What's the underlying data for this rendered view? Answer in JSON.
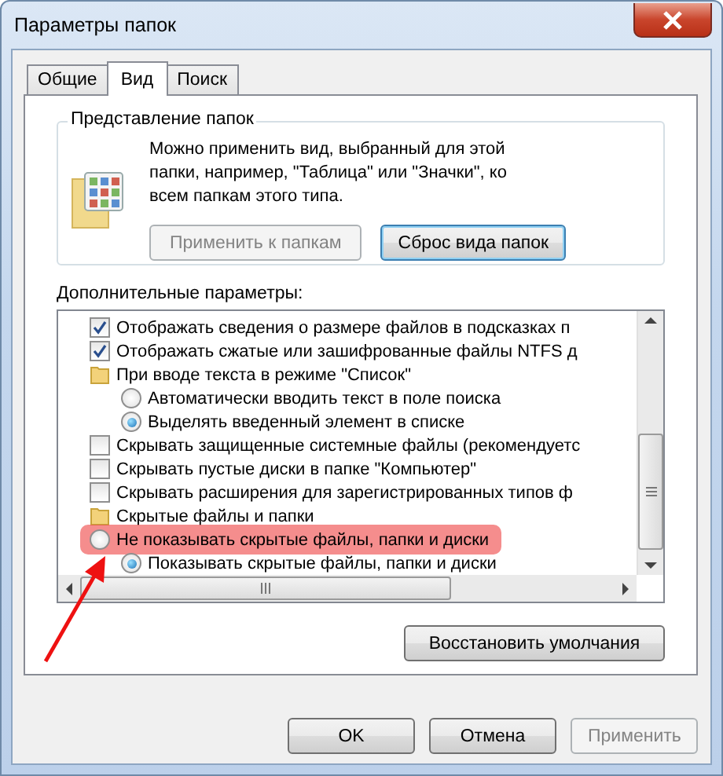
{
  "window": {
    "title": "Параметры папок"
  },
  "tabs": [
    {
      "label": "Общие",
      "selected": false
    },
    {
      "label": "Вид",
      "selected": true
    },
    {
      "label": "Поиск",
      "selected": false
    }
  ],
  "folder_views": {
    "title": "Представление папок",
    "description": "Можно применить вид, выбранный для этой папки, например, \"Таблица\" или \"Значки\", ко всем папкам этого типа.",
    "buttons": [
      {
        "label": "Применить к папкам",
        "disabled": true
      },
      {
        "label": "Сброс вида папок",
        "disabled": false
      }
    ]
  },
  "advanced": {
    "title": "Дополнительные параметры:",
    "items": [
      {
        "kind": "checkbox",
        "label": "Отображать сведения о размере файлов в подсказках п",
        "checked": true
      },
      {
        "kind": "checkbox",
        "label": "Отображать сжатые или зашифрованные файлы NTFS д",
        "checked": true
      },
      {
        "kind": "folder",
        "label": "При вводе текста в режиме \"Список\"",
        "children": [
          {
            "kind": "radio",
            "label": "Автоматически вводить текст в поле поиска",
            "selected": false,
            "highlighted": false
          },
          {
            "kind": "radio",
            "label": "Выделять введенный элемент в списке",
            "selected": true,
            "highlighted": false
          }
        ]
      },
      {
        "kind": "checkbox",
        "label": "Скрывать защищенные системные файлы (рекомендуетс",
        "checked": false
      },
      {
        "kind": "checkbox",
        "label": "Скрывать пустые диски в папке \"Компьютер\"",
        "checked": false
      },
      {
        "kind": "checkbox",
        "label": "Скрывать расширения для зарегистрированных типов ф",
        "checked": false
      },
      {
        "kind": "folder",
        "label": "Скрытые файлы и папки",
        "children": [
          {
            "kind": "radio",
            "label": "Не показывать скрытые файлы, папки и диски",
            "selected": false,
            "highlighted": true
          },
          {
            "kind": "radio",
            "label": "Показывать скрытые файлы, папки и диски",
            "selected": true,
            "highlighted": false
          }
        ]
      }
    ]
  },
  "restore_button": {
    "label": "Восстановить умолчания"
  },
  "buttons": [
    {
      "label": "OK",
      "disabled": false
    },
    {
      "label": "Отмена",
      "disabled": false
    },
    {
      "label": "Применить",
      "disabled": true
    }
  ]
}
